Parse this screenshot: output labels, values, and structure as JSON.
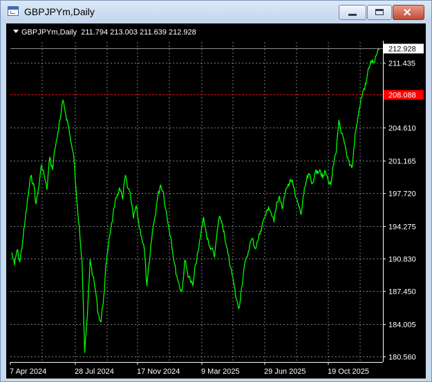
{
  "window": {
    "title": "GBPJPYm,Daily",
    "buttons": {
      "minimize": "minimize",
      "maximize": "maximize",
      "close": "×"
    }
  },
  "chart": {
    "symbol": "GBPJPYm,Daily",
    "ohlc": "211.794 213.003 211.639 212.928",
    "current_price_label": "212.928",
    "hline_label": "208.088",
    "hline_color": "#ff0000",
    "series_color": "#00ff00",
    "background": "#000000"
  },
  "chart_data": {
    "type": "line",
    "y_ticks": [
      "211.435",
      "204.610",
      "201.165",
      "197.720",
      "194.275",
      "190.830",
      "187.450",
      "184.005",
      "180.560"
    ],
    "y_tick_values": [
      211.435,
      204.61,
      201.165,
      197.72,
      194.275,
      190.83,
      187.45,
      184.005,
      180.56
    ],
    "x_ticks": [
      "7 Apr 2024",
      "28 Jul 2024",
      "17 Nov 2024",
      "9 Mar 2025",
      "29 Jun 2025",
      "19 Oct 2025"
    ],
    "ylim": [
      180.0,
      213.6
    ],
    "current_price": 212.928,
    "horizontal_line": 208.088,
    "grid": true,
    "series": [
      {
        "values": [
          191.5,
          190.2,
          191.8,
          190.5,
          192.6,
          195.0,
          197.3,
          199.5,
          198.8,
          196.6,
          198.4,
          200.7,
          199.6,
          198.1,
          201.5,
          200.2,
          202.4,
          204.0,
          205.6,
          207.5,
          206.0,
          204.7,
          203.0,
          201.4,
          197.0,
          194.2,
          190.6,
          181.0,
          185.0,
          190.8,
          189.0,
          187.5,
          185.0,
          184.2,
          186.8,
          190.5,
          193.0,
          194.6,
          196.3,
          197.6,
          198.2,
          197.1,
          199.6,
          198.2,
          197.3,
          195.1,
          196.4,
          194.5,
          193.2,
          191.9,
          188.0,
          190.7,
          193.6,
          195.3,
          197.4,
          198.6,
          197.9,
          196.0,
          194.3,
          192.8,
          190.6,
          189.1,
          188.0,
          187.4,
          190.7,
          189.4,
          188.6,
          188.0,
          190.3,
          191.6,
          193.6,
          195.2,
          193.4,
          192.2,
          191.9,
          191.0,
          193.8,
          195.3,
          194.4,
          192.6,
          191.3,
          189.9,
          188.4,
          186.7,
          185.6,
          187.8,
          190.0,
          191.0,
          192.3,
          193.0,
          191.9,
          192.7,
          193.8,
          194.8,
          195.5,
          196.3,
          195.6,
          194.7,
          196.8,
          197.4,
          196.1,
          197.5,
          198.4,
          199.2,
          198.7,
          197.3,
          196.6,
          195.5,
          197.6,
          199.1,
          199.7,
          198.7,
          199.6,
          200.1,
          200.2,
          199.3,
          200.0,
          199.1,
          198.6,
          200.7,
          202.0,
          205.4,
          204.0,
          203.0,
          201.5,
          200.6,
          200.6,
          204.0,
          205.6,
          207.3,
          208.5,
          209.2,
          210.9,
          211.6,
          211.4,
          212.3,
          212.928
        ]
      }
    ]
  }
}
